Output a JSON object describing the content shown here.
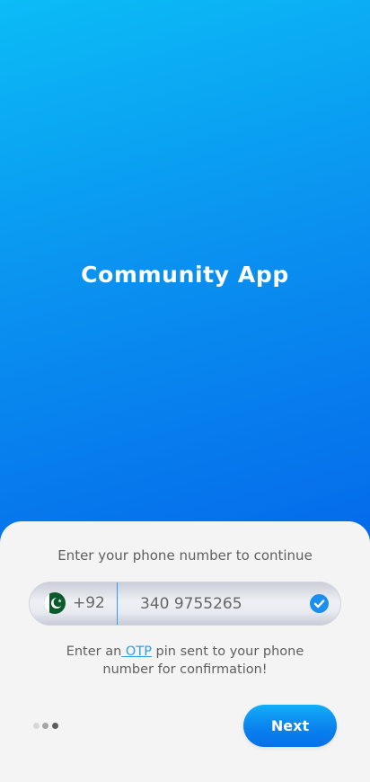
{
  "app": {
    "title": "Community App"
  },
  "form": {
    "instruction": "Enter your phone number to continue",
    "country_flag": "pakistan-flag",
    "dial_code": "+92",
    "phone_value": "340 9755265",
    "valid_icon": "check-circle-icon",
    "otp_note_prefix": "Enter an",
    "otp_link": " OTP",
    "otp_note_suffix": " pin sent to your phone number for confirmation!"
  },
  "pager": {
    "total": 3,
    "active": 3
  },
  "actions": {
    "next_label": "Next"
  },
  "colors": {
    "gradient_top": "#0bbcf6",
    "gradient_bottom": "#0468ea",
    "accent": "#2a9ef3",
    "sheet_bg": "#f4f4f4",
    "text_muted": "#5f5f5f"
  }
}
